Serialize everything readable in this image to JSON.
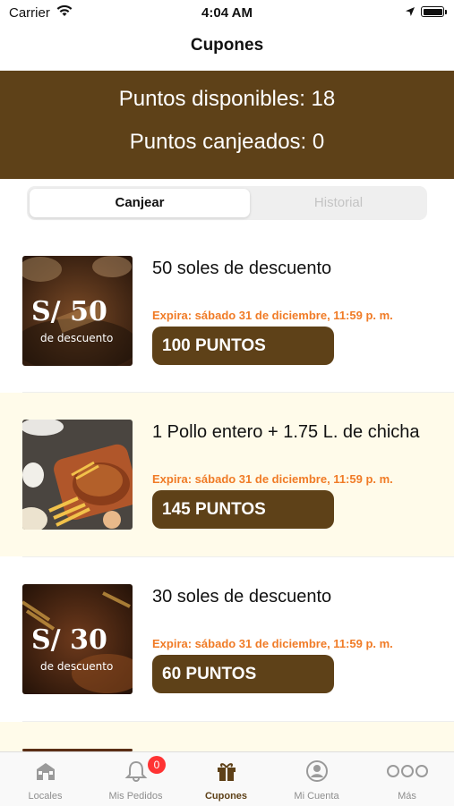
{
  "status_bar": {
    "carrier": "Carrier",
    "time": "4:04 AM"
  },
  "nav": {
    "title": "Cupones"
  },
  "points": {
    "available": "Puntos disponibles: 18",
    "redeemed": "Puntos canjeados: 0"
  },
  "segments": [
    {
      "label": "Canjear",
      "selected": true
    },
    {
      "label": "Historial",
      "selected": false
    }
  ],
  "coupons": [
    {
      "title": "50 soles de descuento",
      "expiry": "Expira: sábado 31 de diciembre, 11:59 p. m.",
      "points": "100 PUNTOS",
      "image_text": "S/ 50",
      "image_sub": "de descuento"
    },
    {
      "title": "1 Pollo entero + 1.75 L. de chicha",
      "expiry": "Expira: sábado 31 de diciembre, 11:59 p. m.",
      "points": "145 PUNTOS"
    },
    {
      "title": "30 soles de descuento",
      "expiry": "Expira: sábado 31 de diciembre, 11:59 p. m.",
      "points": "60 PUNTOS",
      "image_text": "S/ 30",
      "image_sub": "de descuento"
    }
  ],
  "tabs": [
    {
      "label": "Locales",
      "icon": "store-icon"
    },
    {
      "label": "Mis Pedidos",
      "icon": "bell-icon",
      "badge": "0"
    },
    {
      "label": "Cupones",
      "icon": "gift-icon",
      "active": true
    },
    {
      "label": "Mi Cuenta",
      "icon": "user-icon"
    },
    {
      "label": "Más",
      "icon": "more-icon"
    }
  ],
  "colors": {
    "brand_brown": "#5e4118",
    "expiry_orange": "#f07b26",
    "alt_row": "#fffbea"
  }
}
